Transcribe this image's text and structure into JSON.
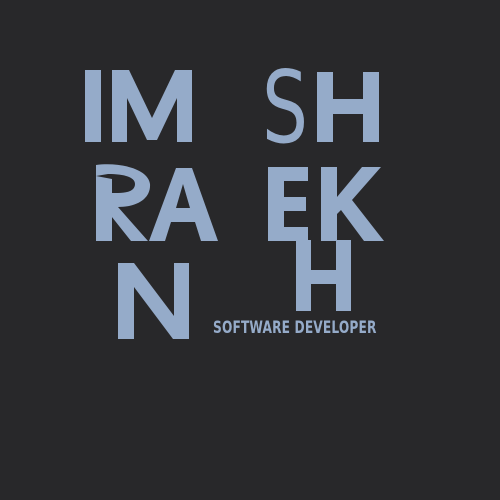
{
  "colors": {
    "background": "#28282a",
    "accent": "#95abc9"
  },
  "logo": {
    "first_name": "IMRAN",
    "last_name": "SHEKH",
    "glyphs": {
      "row1": [
        "I",
        "M",
        "S",
        "H"
      ],
      "row2": [
        "R",
        "A",
        "E",
        "K"
      ],
      "row3": [
        "N",
        "H"
      ]
    }
  },
  "tagline": "SOFTWARE DEVELOPER"
}
